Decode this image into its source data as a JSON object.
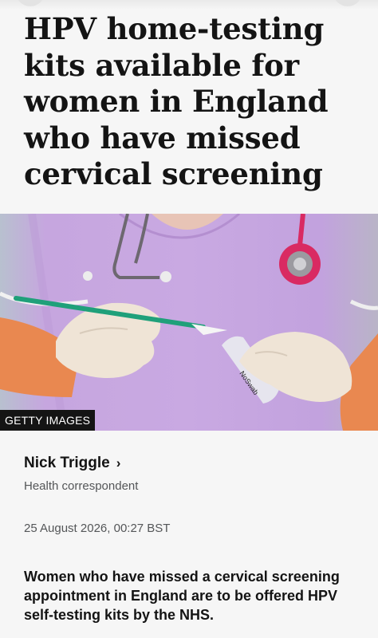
{
  "article": {
    "headline": "HPV home-testing kits available for women in England who have missed cervical screening",
    "image_credit": "GETTY IMAGES",
    "author": "Nick Triggle",
    "author_role": "Health correspondent",
    "date": "25 August 2026, 00:27 BST",
    "lede": "Women who have missed a cervical screening appointment in England are to be offered HPV self-testing kits by the NHS."
  },
  "icons": {
    "author_link": "chevron-right-icon"
  }
}
